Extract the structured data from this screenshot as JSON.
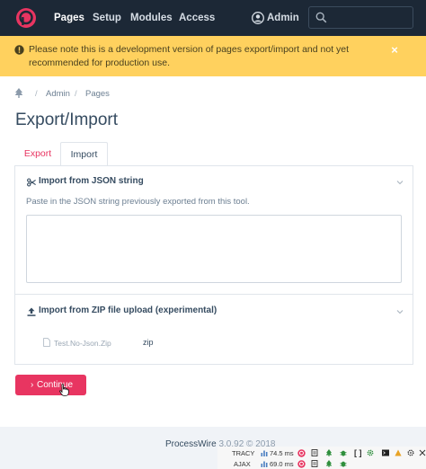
{
  "nav": {
    "pages": "Pages",
    "setup": "Setup",
    "modules": "Modules",
    "access": "Access",
    "user": "Admin",
    "search_value": ""
  },
  "notice": {
    "text": "Please note this is a development version of pages export/import and not yet recommended for production use.",
    "close": "×"
  },
  "breadcrumb": {
    "sep": "/",
    "admin": "Admin",
    "pages": "Pages"
  },
  "page_title": "Export/Import",
  "tabs": [
    {
      "label": "Export",
      "active": false
    },
    {
      "label": "Import",
      "active": true
    }
  ],
  "json_section": {
    "title": "Import from JSON string",
    "description": "Paste in the JSON string previously exported from this tool.",
    "value": ""
  },
  "zip_section": {
    "title": "Import from ZIP file upload (experimental)",
    "file_name": "Test.No-Json.Zip",
    "file_type": "zip"
  },
  "continue_button": {
    "chevron": "›",
    "label": "Continue"
  },
  "footer": {
    "brand": "ProcessWire",
    "version": "3.0.92 © 2018"
  },
  "tracy": {
    "tracy_label": "TRACY",
    "tracy_time": "74.5 ms",
    "ajax_label": "AJAX",
    "ajax_time": "69.0 ms",
    "brackets": "[ ]"
  },
  "colors": {
    "accent": "#e83561",
    "masthead": "#1c2836",
    "notice": "#ffd15e"
  }
}
